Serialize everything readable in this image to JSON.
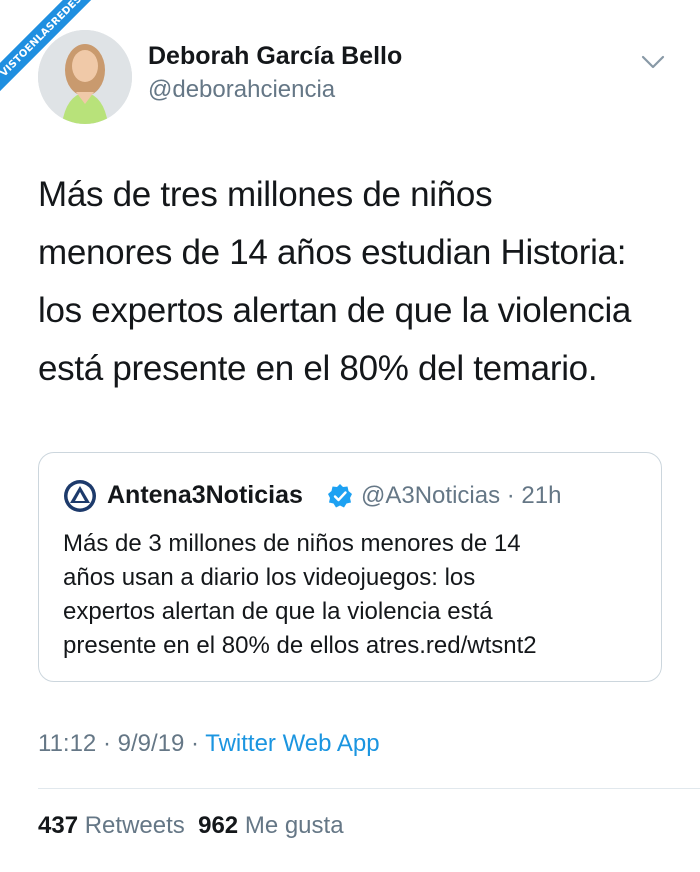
{
  "watermark": "VISTOENLASREDES",
  "author": {
    "name": "Deborah García Bello",
    "handle": "@deborahciencia"
  },
  "tweet": {
    "lines": [
      "Más de tres millones de niños",
      "menores de 14 años estudian Historia:",
      "los expertos alertan de que la violencia",
      "está presente en el 80% del temario."
    ]
  },
  "quoted": {
    "name": "Antena3Noticias",
    "handle_time": "@A3Noticias · 21h",
    "lines": [
      "Más de 3 millones de niños menores de 14",
      "años usan a diario los videojuegos: los",
      "expertos alertan de que la violencia está",
      "presente en el 80% de ellos atres.red/wtsnt2"
    ]
  },
  "meta": {
    "time_date": "11:12 · 9/9/19 · ",
    "app": "Twitter Web App"
  },
  "stats": {
    "retweets_count": "437",
    "retweets_label": "Retweets",
    "likes_count": "962",
    "likes_label": "Me gusta"
  },
  "colors": {
    "link": "#1b95e0",
    "secondary_text": "#657786",
    "ribbon": "#1f8fe0"
  },
  "icons": {
    "menu": "chevron-down-icon",
    "verified": "verified-badge-icon",
    "source_logo": "antena3-logo-icon"
  }
}
